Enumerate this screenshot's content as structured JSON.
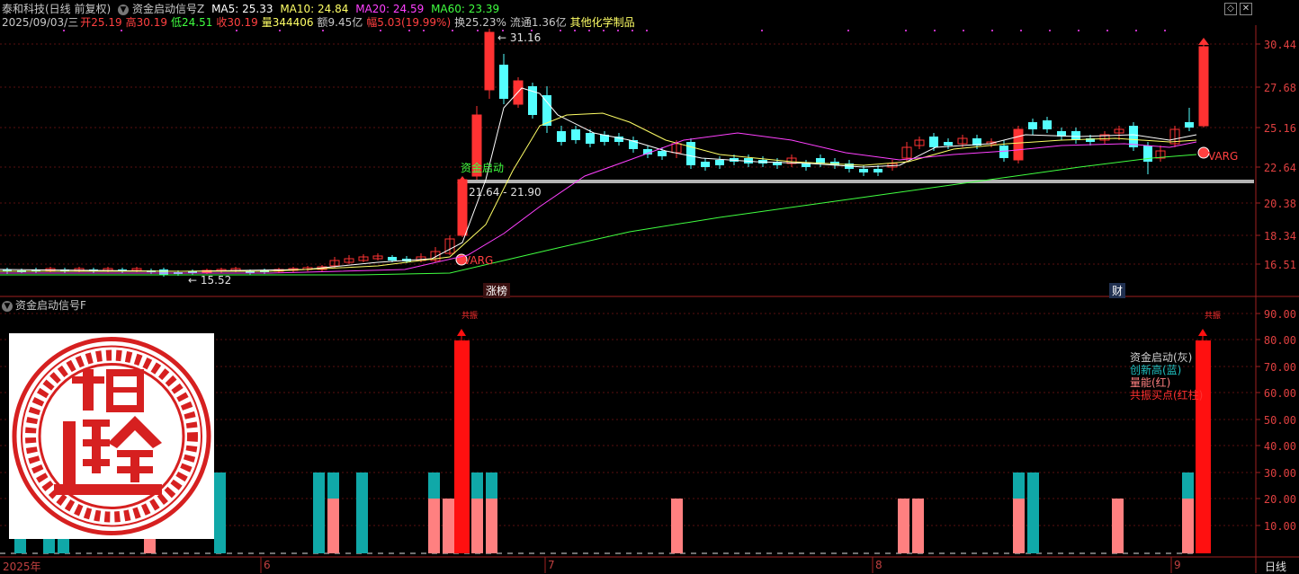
{
  "header": {
    "stock_name": "泰和科技(日线 前复权)",
    "indicator_name": "资金启动信号Z",
    "ma5": "MA5: 25.33",
    "ma10": "MA10: 24.84",
    "ma20": "MA20: 24.59",
    "ma60": "MA60: 23.39",
    "date": "2025/09/03/三",
    "open_label": "开",
    "open": "25.19",
    "high_label": "高",
    "high": "30.19",
    "low_label": "低",
    "low": "24.51",
    "close_label": "收",
    "close": "30.19",
    "vol_label": "量",
    "volume": "344406",
    "amount": "额9.45亿",
    "change_label": "幅",
    "change": "5.03(19.99%)",
    "turnover": "换25.23%",
    "float": "流通1.36亿",
    "sector": "其他化学制品"
  },
  "window_buttons": {
    "restore": "◇",
    "close": "✕"
  },
  "main_axis": [
    "30.44",
    "27.68",
    "25.16",
    "22.64",
    "20.38",
    "18.34",
    "16.51"
  ],
  "annotations": {
    "high_price": "31.16",
    "low_price": "15.52",
    "signal_label": "资金启动",
    "range_label": "21.64 - 21.90",
    "varg1": "VARG",
    "varg2": "VARG",
    "limit_up_tag": "涨榜",
    "finance_tag": "财"
  },
  "sub_panel": {
    "title": "资金启动信号F",
    "axis": [
      "90.00",
      "80.00",
      "70.00",
      "60.00",
      "50.00",
      "40.00",
      "30.00",
      "20.00",
      "10.00"
    ],
    "marker1": "共振",
    "marker2": "共振",
    "legend": [
      {
        "text": "资金启动(灰)",
        "color": "#d0d0d0"
      },
      {
        "text": "创新高(蓝)",
        "color": "#20c0c0"
      },
      {
        "text": "量能(红)",
        "color": "#ff8080"
      },
      {
        "text": "共振买点(红柱)",
        "color": "#ff3030"
      }
    ]
  },
  "x_axis": {
    "labels": [
      "2025年",
      "6",
      "7",
      "8",
      "9"
    ],
    "period": "日线"
  },
  "colors": {
    "up": "#ff3232",
    "down": "#54ffff",
    "ma5": "#ffffff",
    "ma10": "#ffff66",
    "ma20": "#ff40ff",
    "ma60": "#40ff40",
    "support_line": "#b4b4b4"
  },
  "icons": {
    "stamp": "seal-stamp"
  }
}
